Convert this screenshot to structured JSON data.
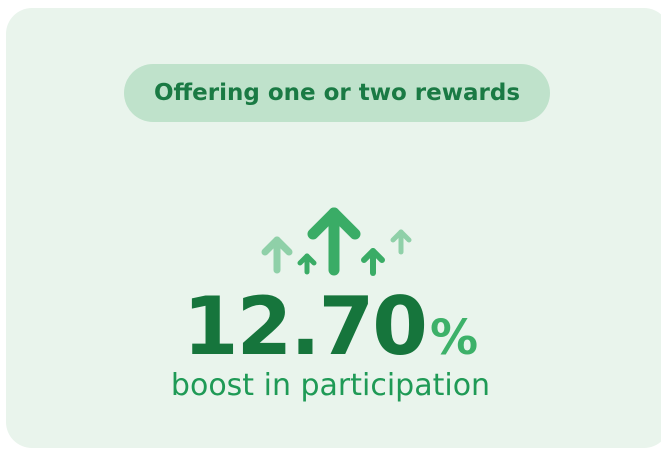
{
  "badge": {
    "label": "Offering one or two rewards"
  },
  "stat": {
    "value": "12.70",
    "unit": "%",
    "caption": "boost in participation"
  },
  "colors": {
    "card_background": "#e9f4ec",
    "badge_background": "#bfe2cb",
    "badge_text": "#1a7a44",
    "stat_value": "#16753c",
    "stat_unit": "#3db169",
    "caption": "#1f9a56",
    "arrow_main": "#3aac66",
    "arrow_light": "#8fd0a8"
  },
  "icons": [
    "up-arrow-icon"
  ]
}
